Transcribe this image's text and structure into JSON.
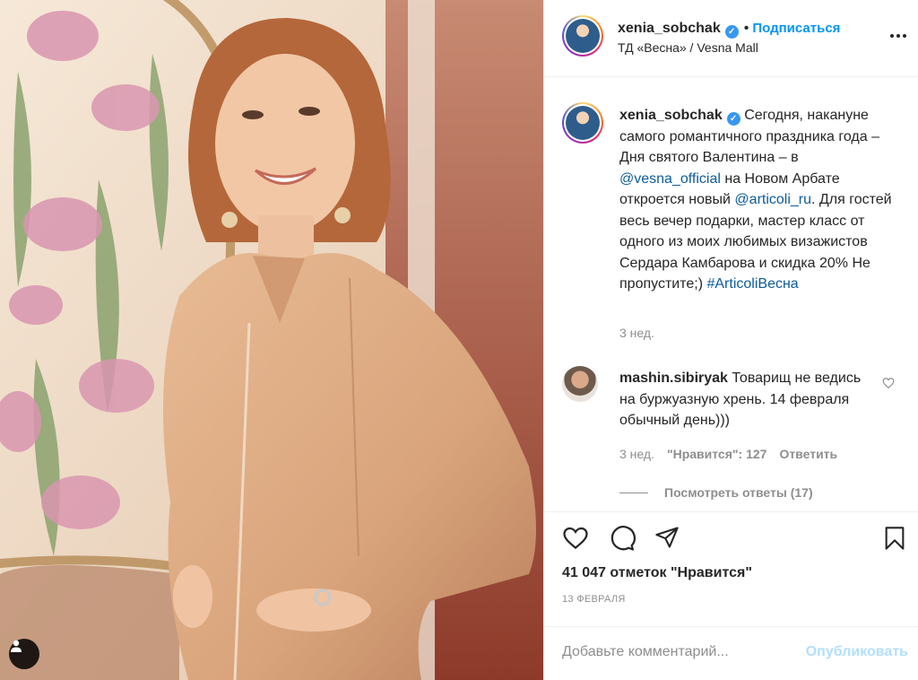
{
  "post": {
    "author": "xenia_sobchak",
    "follow_label": "Подписаться",
    "location": "ТД «Весна» / Vesna Mall"
  },
  "caption": {
    "author": "xenia_sobchak",
    "text_1": "Сегодня, накануне самого романтичного праздника года – Дня святого Валентина – в",
    "mention_1": "@vesna_official",
    "text_2": "на Новом Арбате откроется новый",
    "mention_2": "@articoli_ru",
    "text_3": ". Для гостей весь вечер подарки, мастер класс от одного из моих любимых визажистов Сердара Камбарова и скидка 20% Не пропустите;)",
    "hashtag": "#ArticoliВесна",
    "time": "3 нед."
  },
  "comment": {
    "author": "mashin.sibiryak",
    "text": "Товарищ не ведись на буржуазную хрень. 14 февраля обычный день)))",
    "time": "3 нед.",
    "likes": "\"Нравится\": 127",
    "reply_label": "Ответить",
    "view_replies": "Посмотреть ответы (17)"
  },
  "stats": {
    "likes": "41 047 отметок \"Нравится\"",
    "date": "13 ФЕВРАЛЯ"
  },
  "add_comment": {
    "placeholder": "Добавьте комментарий...",
    "post_label": "Опубликовать"
  },
  "icons": {
    "like": "heart-icon",
    "comment": "comment-bubble-icon",
    "share": "paper-plane-icon",
    "save": "bookmark-icon",
    "more": "more-dots-icon",
    "user_tag": "person-icon"
  },
  "colors": {
    "link": "#0095f6",
    "verified": "#3897f0",
    "muted": "#8e8e8e",
    "post_disabled": "#b2dffc"
  }
}
